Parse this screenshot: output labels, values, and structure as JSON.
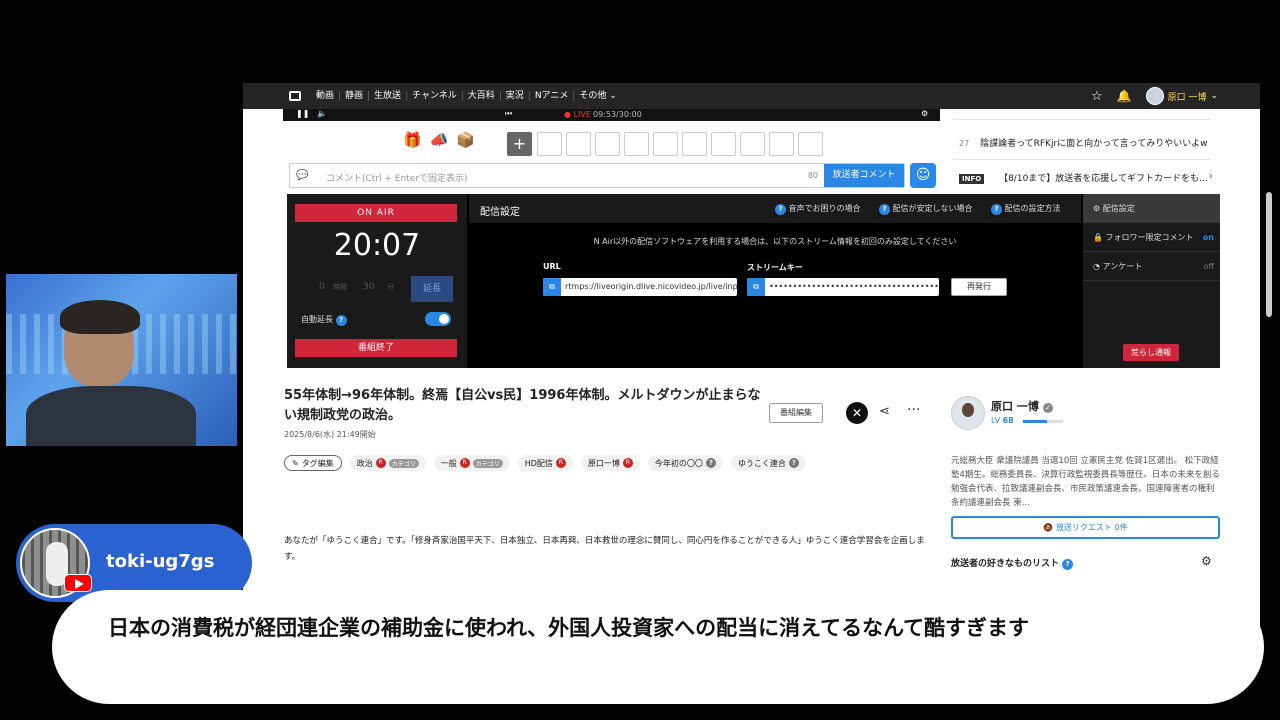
{
  "nav": {
    "items": [
      "動画",
      "静画",
      "生放送",
      "チャンネル",
      "大百科",
      "実況",
      "Nアニメ",
      "その他"
    ],
    "user_name": "原口 一博"
  },
  "player": {
    "live_label": "LIVE",
    "elapsed": "09:53/30:00"
  },
  "comment_input": {
    "placeholder": "コメント(Ctrl + Enterで固定表示)",
    "count": "80",
    "caster_comment_button": "放送者コメント"
  },
  "ranking": {
    "item_27_num": "27",
    "item_27_text": "陰謀論者ってRFKjrに面と向かって言ってみりやいいよw",
    "info_badge": "INFO",
    "info_text": "【8/10まで】放送者を応援してギフトカードをも…"
  },
  "broadcast": {
    "on_air": "ON AIR",
    "clock": "20:07",
    "ext_hours": "0",
    "ext_hours_unit": "時間",
    "ext_minutes": "30",
    "ext_minutes_unit": "分",
    "extend_button": "延長",
    "auto_extend": "自動延長",
    "end_button": "番組終了"
  },
  "settings": {
    "title": "配信設定",
    "help_1": "音声でお困りの場合",
    "help_2": "配信が安定しない場合",
    "help_3": "配信の設定方法",
    "note": "N Air以外の配信ソフトウェアを利用する場合は、以下のストリーム情報を初回のみ設定してください",
    "url_label": "URL",
    "url_value": "rtmps://liveorigin.dlive.nicovideo.jp/live/inpu",
    "key_label": "ストリームキー",
    "key_value": "••••••••••••••••••••••••••••••••••••••••••••••••••",
    "reissue_button": "再発行"
  },
  "side_menu": {
    "item_1": "配信設定",
    "item_2": "フォロワー限定コメント",
    "item_2_state": "on",
    "item_3": "アンケート",
    "item_3_state": "off",
    "ara_button": "荒らし通報"
  },
  "program": {
    "title": "55年体制→96年体制。終焉【自公vs民】1996年体制。メルトダウンが止まらない規制政党の政治。",
    "date": "2025/8/6(水) 21:49開始",
    "edit_button": "番組編集",
    "tag_edit": "タグ編集",
    "tags": [
      {
        "label": "政治",
        "r": "R",
        "cat": "カテゴリ"
      },
      {
        "label": "一般",
        "r": "R",
        "cat": "カテゴリ"
      },
      {
        "label": "HD配信",
        "r": "R"
      },
      {
        "label": "原口一博",
        "r": "R"
      },
      {
        "label": "今年初の〇〇",
        "q": "?"
      },
      {
        "label": "ゆうこく連合",
        "q": "?"
      }
    ],
    "description": "あなたが「ゆうこく連合」です。「修身斉家治国平天下、日本独立、日本再興、日本救世の理念に賛同し、同心円を作ることができる人」ゆうこく連合学習会を企画します。"
  },
  "caster": {
    "name": "原口 一博",
    "level_label": "LV",
    "level": "68",
    "level_progress": 0.6,
    "profile": "元総務大臣 衆議院議員 当選10回 立憲民主党 佐賀1区選出。 松下政経塾4期生。総務委員長、決算行政監視委員長等歴任。日本の未来を創る勉強会代表、拉致議連副会長、市民政策議連会長、国連障害者の権利条約議連副会長 東...",
    "request_button": "放送リクエスト 0件",
    "fav_title": "放送者の好きなものリスト"
  },
  "overlay": {
    "channel_name": "toki-ug7gs",
    "comment": "日本の消費税が経団連企業の補助金に使われ、外国人投資家への配当に消えてるなんて酷すぎます"
  }
}
